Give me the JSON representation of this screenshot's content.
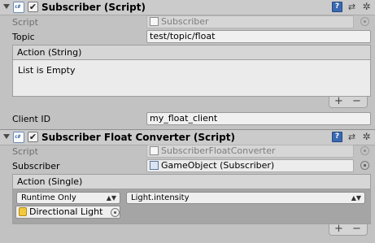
{
  "subscriber": {
    "title": "Subscriber (Script)",
    "script_label": "Script",
    "script_value": "Subscriber",
    "topic_label": "Topic",
    "topic_value": "test/topic/float",
    "event_header": "Action (String)",
    "event_empty": "List is Empty",
    "add_label": "+",
    "remove_label": "−",
    "client_id_label": "Client ID",
    "client_id_value": "my_float_client"
  },
  "converter": {
    "title": "Subscriber Float Converter (Script)",
    "script_label": "Script",
    "script_value": "SubscriberFloatConverter",
    "subscriber_label": "Subscriber",
    "subscriber_value": "GameObject (Subscriber)",
    "event_header": "Action (Single)",
    "runtime_option": "Runtime Only",
    "function_option": "Light.intensity",
    "target_object": "Directional Light",
    "add_label": "+",
    "remove_label": "−"
  },
  "icons": {
    "foldout": "triangle-down",
    "script": "cs-script-icon",
    "help": "help-book-icon",
    "presets": "presets-icon",
    "settings": "gear-icon",
    "object_picker": "circle-dot-picker"
  },
  "glyphs": {
    "checkmark": "✔",
    "cs": "c#",
    "help": "?",
    "presets": "⇄",
    "gear": "✲",
    "arrows": "▲▼"
  },
  "colors": {
    "panel_bg": "#c2c2c2",
    "header_bg": "#cbcbcb",
    "help_icon": "#3b69b0",
    "light_icon": "#f3c93b"
  }
}
